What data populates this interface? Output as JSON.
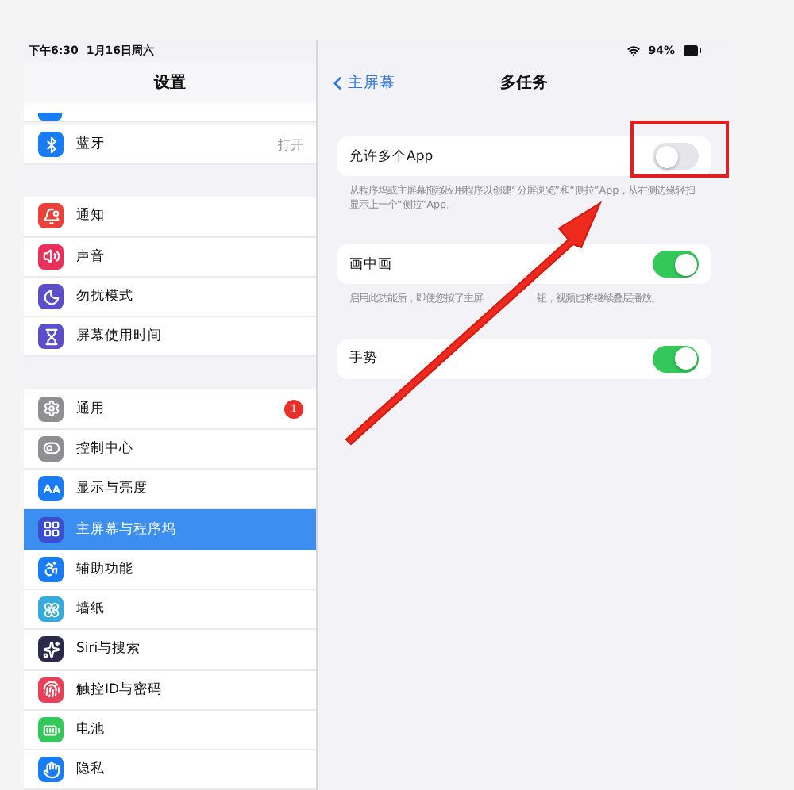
{
  "status_bar": {
    "time": "下午6:30",
    "date": "1月16日周六",
    "battery": "94%"
  },
  "sidebar": {
    "title": "设置",
    "groups": [
      {
        "items": [
          {
            "label": "蓝牙",
            "value": "打开",
            "color": "#1a7cf5",
            "selected": false
          }
        ]
      },
      {
        "items": [
          {
            "label": "通知",
            "color": "#e8423a",
            "selected": false
          },
          {
            "label": "声音",
            "color": "#e9305a",
            "selected": false
          },
          {
            "label": "勿扰模式",
            "color": "#5a4fc8",
            "selected": false
          },
          {
            "label": "屏幕使用时间",
            "color": "#5a4fc8",
            "selected": false
          }
        ]
      },
      {
        "items": [
          {
            "label": "通用",
            "badge": "1",
            "color": "#8e8e93",
            "selected": false
          },
          {
            "label": "控制中心",
            "color": "#8e8e93",
            "selected": false
          },
          {
            "label": "显示与亮度",
            "color": "#1a7cf5",
            "selected": false
          },
          {
            "label": "主屏幕与程序坞",
            "color": "#3a4fd0",
            "selected": true
          },
          {
            "label": "辅助功能",
            "color": "#1a7cf5",
            "selected": false
          },
          {
            "label": "墙纸",
            "color": "#36aadc",
            "selected": false
          },
          {
            "label": "Siri与搜索",
            "color": "#2a2a4a",
            "selected": false
          },
          {
            "label": "触控ID与密码",
            "color": "#e9405a",
            "selected": false
          },
          {
            "label": "电池",
            "color": "#34c759",
            "selected": false
          },
          {
            "label": "隐私",
            "color": "#1a7cf5",
            "selected": false
          }
        ]
      }
    ]
  },
  "detail": {
    "back": "主屏幕",
    "title": "多任务",
    "settings": [
      {
        "label": "允许多个App",
        "on": false,
        "footer": [
          "从程序坞或主屏幕拖移应用程序以创建“分屏浏览”和“侧拉”App，从右侧边缘轻扫显示上一个“侧拉”App。"
        ]
      },
      {
        "label": "画中画",
        "on": true,
        "footer": [
          "启用此功能后，即使您按了主屏",
          "钮，视频也将继续叠层播放。"
        ]
      },
      {
        "label": "手势",
        "on": true
      }
    ]
  }
}
